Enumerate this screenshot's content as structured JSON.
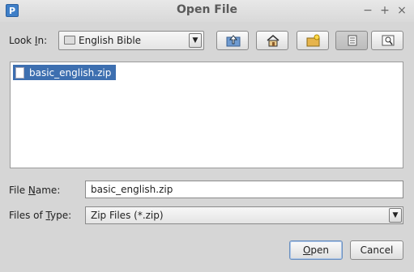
{
  "window": {
    "app_icon_letter": "P",
    "title": "Open File",
    "minimize_glyph": "−",
    "maximize_glyph": "+",
    "close_glyph": "×"
  },
  "look_in": {
    "label_before": "Look ",
    "label_mnemonic": "I",
    "label_after": "n:",
    "value": "English Bible",
    "icon": "folder-icon"
  },
  "toolbar": {
    "buttons": [
      {
        "name": "up-one-level-button",
        "icon": "up-folder-icon"
      },
      {
        "name": "home-button",
        "icon": "home-icon"
      },
      {
        "name": "new-folder-button",
        "icon": "new-folder-icon"
      },
      {
        "name": "list-view-button",
        "icon": "list-view-icon",
        "pressed": true
      },
      {
        "name": "details-view-button",
        "icon": "details-view-icon"
      }
    ]
  },
  "files": [
    {
      "name": "basic_english.zip",
      "selected": true,
      "icon": "file-icon"
    }
  ],
  "file_name": {
    "label_before": "File ",
    "label_mnemonic": "N",
    "label_after": "ame:",
    "value": "basic_english.zip"
  },
  "files_of_type": {
    "label_before": "Files of ",
    "label_mnemonic": "T",
    "label_after": "ype:",
    "value": "Zip Files (*.zip)"
  },
  "actions": {
    "open_mnemonic": "O",
    "open_rest": "pen",
    "cancel_label": "Cancel"
  },
  "colors": {
    "selection": "#3d6fb0",
    "background": "#d6d6d6"
  }
}
